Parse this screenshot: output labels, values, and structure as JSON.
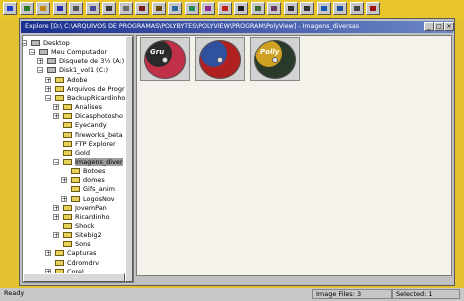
{
  "toolbar": {
    "buttons": [
      {
        "icon": "yellow-square-icon",
        "color": "#1f3fcf"
      },
      {
        "icon": "picture-icon",
        "color": "#2b7a2b"
      },
      {
        "icon": "open-folder-icon",
        "color": "#c08a12"
      },
      {
        "icon": "save-icon",
        "color": "#2b2bb0"
      },
      {
        "icon": "camera-icon",
        "color": "#555555"
      },
      {
        "icon": "grid-icon",
        "color": "#4a4a9a"
      },
      {
        "icon": "print-icon",
        "color": "#3a3a3a"
      },
      {
        "icon": "copy-icon",
        "color": "#6a6a6a"
      },
      {
        "icon": "cut-icon",
        "color": "#7a1a1a"
      },
      {
        "icon": "paste-icon",
        "color": "#6b4a10"
      },
      {
        "icon": "move-icon",
        "color": "#2a6aa0"
      },
      {
        "icon": "crop-icon",
        "color": "#2a8a5a"
      },
      {
        "icon": "resize-icon",
        "color": "#8a2a8a"
      },
      {
        "icon": "color-icon",
        "color": "#c02020"
      },
      {
        "icon": "contrast-icon",
        "color": "#202020"
      },
      {
        "icon": "rotate-icon",
        "color": "#3a6a3a"
      },
      {
        "icon": "flip-icon",
        "color": "#6a3a6a"
      },
      {
        "icon": "prev-icon",
        "color": "#333333"
      },
      {
        "icon": "next-icon",
        "color": "#333333"
      },
      {
        "icon": "slideshow-icon",
        "color": "#1a5ab0"
      },
      {
        "icon": "info-icon",
        "color": "#2050a0"
      },
      {
        "icon": "settings-icon",
        "color": "#444444"
      },
      {
        "icon": "help-icon",
        "color": "#a01010"
      }
    ]
  },
  "window": {
    "title": "Explore [D:\\ C:\\ARQUIVOS DE PROGRAMAS\\POLYBYTES\\POLYVIEW\\PROGRAM\\PolyView] - Imagens_diversas",
    "minimize": "_",
    "maximize": "□",
    "close": "×"
  },
  "tree": {
    "items": [
      {
        "label": "Desktop",
        "kind": "desktop",
        "indent": 0,
        "exp": "−"
      },
      {
        "label": "Meu Computador",
        "kind": "computer",
        "indent": 1,
        "exp": "−"
      },
      {
        "label": "Disquete de 3½ (A:)",
        "kind": "drive",
        "indent": 2,
        "exp": "+"
      },
      {
        "label": "Disk1_vol1 (C:)",
        "kind": "drive",
        "indent": 2,
        "exp": "−"
      },
      {
        "label": "Adobe",
        "kind": "folder",
        "indent": 3,
        "exp": "+"
      },
      {
        "label": "Arquivos de Progra",
        "kind": "folder",
        "indent": 3,
        "exp": "+"
      },
      {
        "label": "BackupRicardinho",
        "kind": "folder",
        "indent": 3,
        "exp": "−"
      },
      {
        "label": "Analises",
        "kind": "folder",
        "indent": 4,
        "exp": "+"
      },
      {
        "label": "Dicasphotosho",
        "kind": "folder",
        "indent": 4,
        "exp": "+"
      },
      {
        "label": "Eyecandy",
        "kind": "folder",
        "indent": 4,
        "exp": ""
      },
      {
        "label": "fireworks_beta",
        "kind": "folder",
        "indent": 4,
        "exp": ""
      },
      {
        "label": "FTP Explorer",
        "kind": "folder",
        "indent": 4,
        "exp": ""
      },
      {
        "label": "Gold",
        "kind": "folder",
        "indent": 4,
        "exp": ""
      },
      {
        "label": "Imagens_diver",
        "kind": "folder",
        "indent": 4,
        "exp": "−",
        "selected": true
      },
      {
        "label": "Botoes",
        "kind": "folder",
        "indent": 5,
        "exp": ""
      },
      {
        "label": "domes",
        "kind": "folder",
        "indent": 5,
        "exp": "+"
      },
      {
        "label": "Gifs_anim",
        "kind": "folder",
        "indent": 5,
        "exp": ""
      },
      {
        "label": "LogosNov",
        "kind": "folder",
        "indent": 5,
        "exp": "+"
      },
      {
        "label": "JovemPan",
        "kind": "folder",
        "indent": 4,
        "exp": "+"
      },
      {
        "label": "Ricardinho",
        "kind": "folder",
        "indent": 4,
        "exp": "+"
      },
      {
        "label": "Shock",
        "kind": "folder",
        "indent": 4,
        "exp": ""
      },
      {
        "label": "Sitebig2",
        "kind": "folder",
        "indent": 4,
        "exp": "+"
      },
      {
        "label": "Sons",
        "kind": "folder",
        "indent": 4,
        "exp": ""
      },
      {
        "label": "Capturas",
        "kind": "folder",
        "indent": 3,
        "exp": "+"
      },
      {
        "label": "Cdromdrv",
        "kind": "folder",
        "indent": 3,
        "exp": ""
      },
      {
        "label": "Corel",
        "kind": "folder",
        "indent": 3,
        "exp": "+"
      }
    ]
  },
  "thumbnails": [
    {
      "caption": "Gru",
      "disc_color": "#c03048",
      "accent": "#2a2a2a"
    },
    {
      "caption": "",
      "disc_color": "#b02020",
      "accent": "#3050a0"
    },
    {
      "caption": "Polly",
      "disc_color": "#2a3a2a",
      "accent": "#d0a020"
    }
  ],
  "statusbar": {
    "ready": "Ready",
    "image_files": "Image Files: 3",
    "selected": "Selected: 1"
  }
}
